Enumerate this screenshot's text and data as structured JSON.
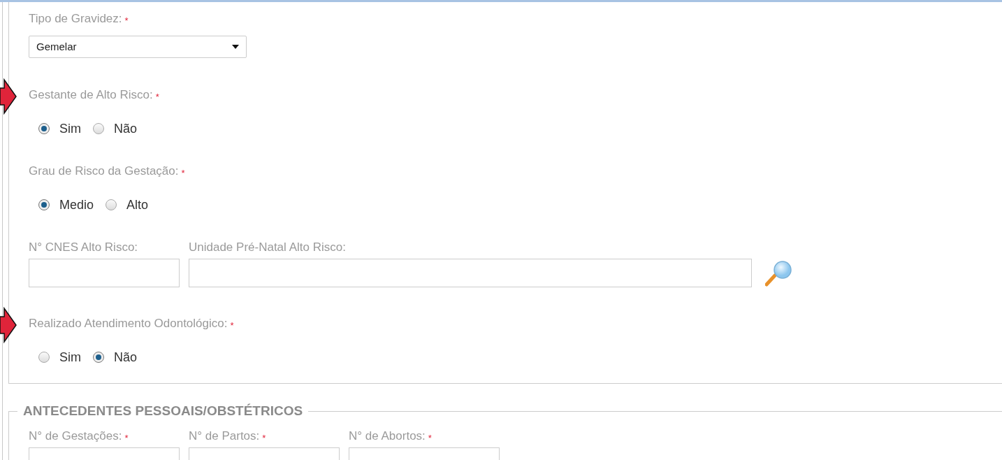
{
  "sections": [
    {
      "fields": [
        {
          "kind": "select",
          "label": "Tipo de Gravidez:",
          "required_mark": "*",
          "value": "Gemelar"
        },
        {
          "kind": "radio",
          "label": "Gestante de Alto Risco:",
          "required_mark": "*",
          "annotated": true,
          "options": [
            {
              "label": "Sim",
              "selected": true
            },
            {
              "label": "Não",
              "selected": false
            }
          ]
        },
        {
          "kind": "radio",
          "label": "Grau de Risco da Gestação:",
          "required_mark": "*",
          "options": [
            {
              "label": "Medio",
              "selected": true
            },
            {
              "label": "Alto",
              "selected": false
            }
          ]
        },
        {
          "kind": "text_row",
          "inputs": [
            {
              "label": "N° CNES Alto Risco:",
              "lookup": false
            },
            {
              "label": "Unidade Pré-Natal Alto Risco:",
              "lookup": true
            }
          ]
        },
        {
          "kind": "radio",
          "label": "Realizado Atendimento Odontológico:",
          "required_mark": "*",
          "annotated": true,
          "options": [
            {
              "label": "Sim",
              "selected": false
            },
            {
              "label": "Não",
              "selected": true
            }
          ]
        }
      ]
    },
    {
      "legend": "ANTECEDENTES PESSOAIS/OBSTÉTRICOS",
      "fields": [
        {
          "kind": "text_row",
          "inputs": [
            {
              "label": "N° de Gestações:",
              "required_mark": "*",
              "lookup": false
            },
            {
              "label": "N° de Partos:",
              "required_mark": "*",
              "lookup": false
            },
            {
              "label": "N° de Abortos:",
              "required_mark": "*",
              "lookup": false
            }
          ]
        }
      ]
    }
  ]
}
